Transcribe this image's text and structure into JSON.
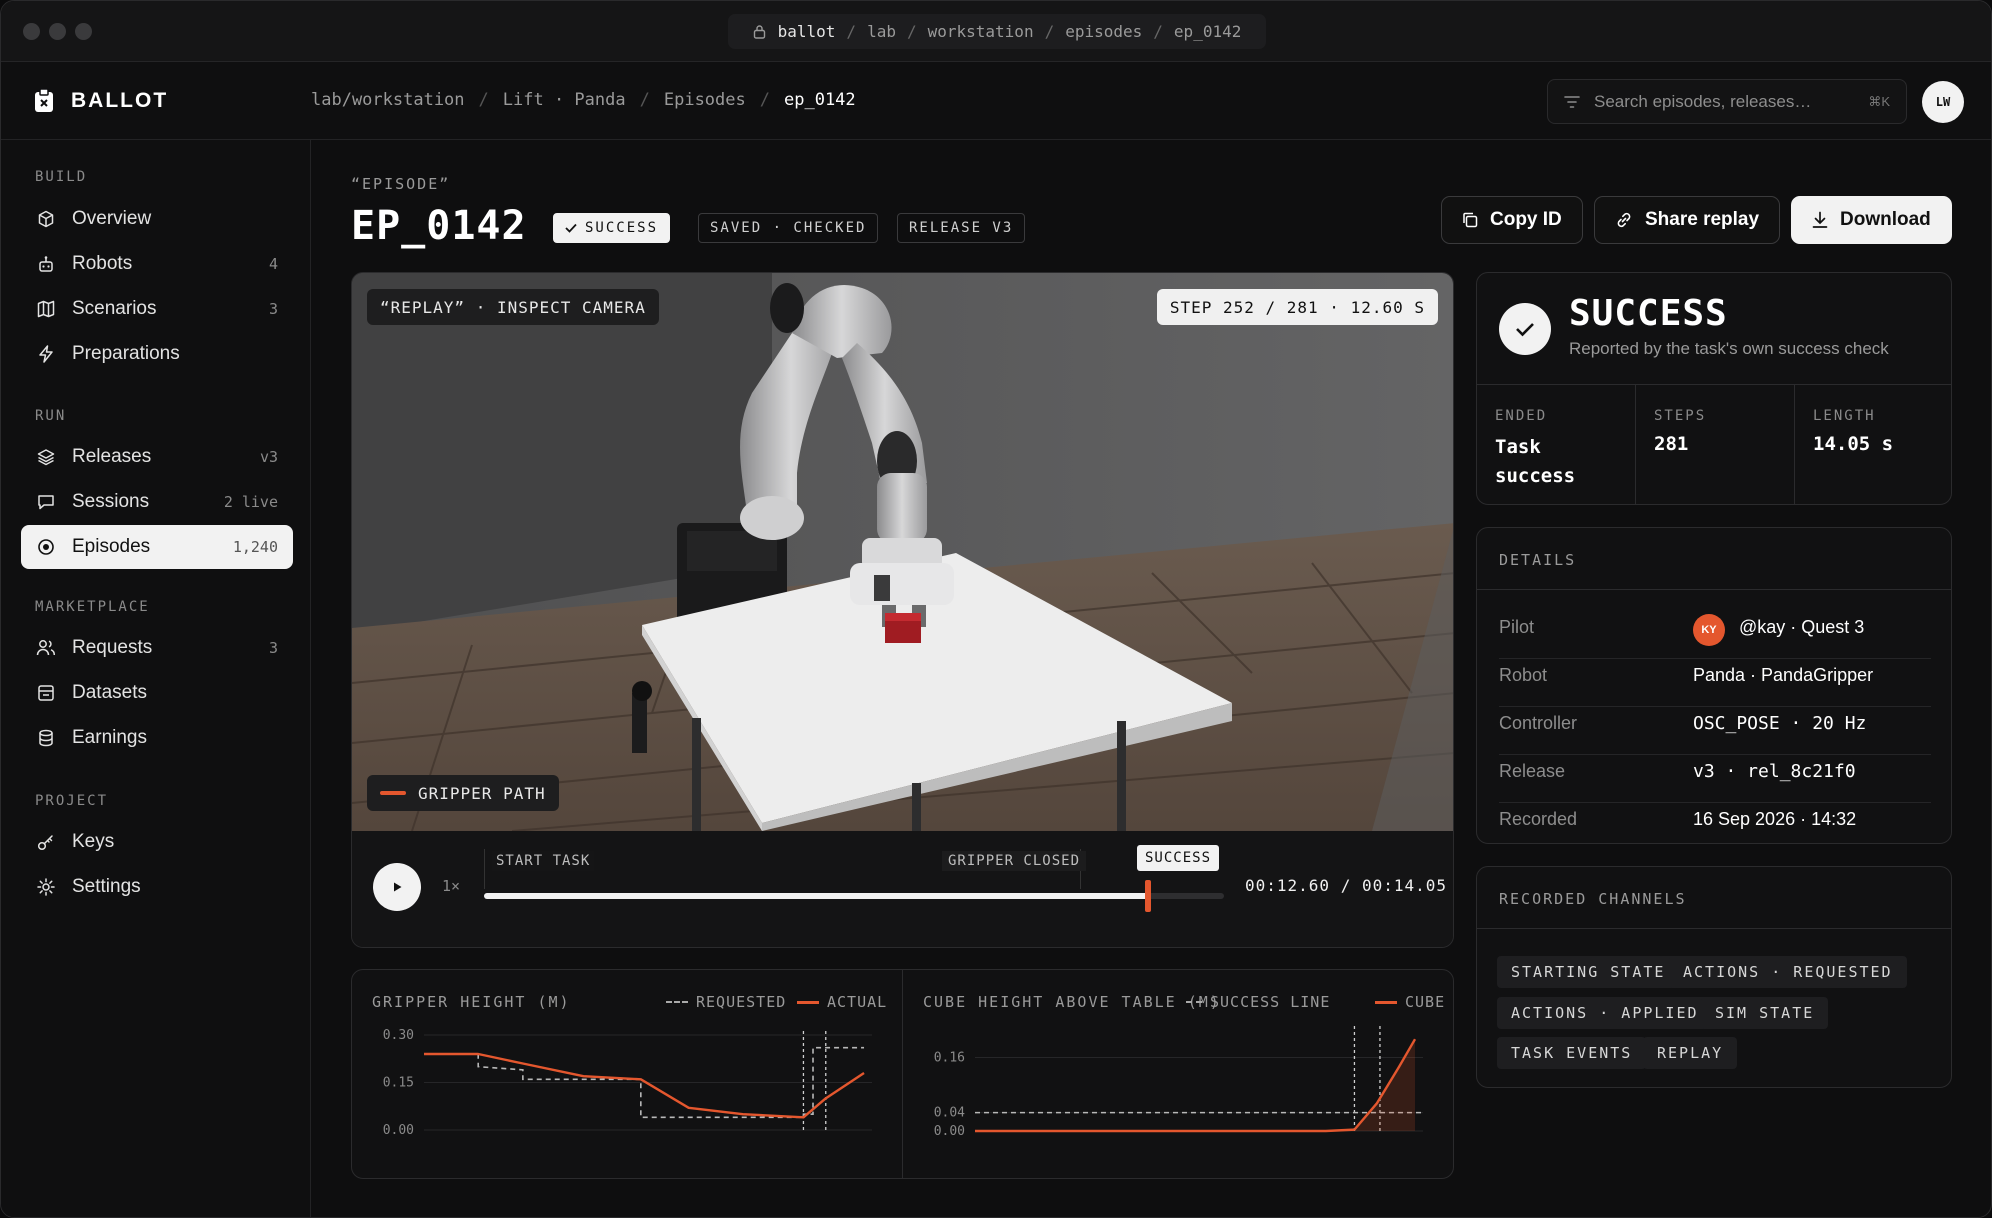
{
  "window": {
    "url_parts": [
      "ballot",
      "lab",
      "workstation",
      "episodes",
      "ep_0142"
    ]
  },
  "brand": {
    "name": "BALLOT"
  },
  "breadcrumb": [
    "lab/workstation",
    "Lift · Panda",
    "Episodes",
    "ep_0142"
  ],
  "search": {
    "placeholder": "Search episodes, releases…",
    "shortcut": "⌘K"
  },
  "user": {
    "initials": "LW"
  },
  "sidebar": {
    "sections": [
      "BUILD",
      "RUN",
      "MARKETPLACE",
      "PROJECT"
    ],
    "items": [
      {
        "label": "Overview",
        "count": ""
      },
      {
        "label": "Robots",
        "count": "4"
      },
      {
        "label": "Scenarios",
        "count": "3"
      },
      {
        "label": "Preparations",
        "count": ""
      },
      {
        "label": "Releases",
        "count": "v3"
      },
      {
        "label": "Sessions",
        "count": "2 live"
      },
      {
        "label": "Episodes",
        "count": "1,240"
      },
      {
        "label": "Requests",
        "count": "3"
      },
      {
        "label": "Datasets",
        "count": ""
      },
      {
        "label": "Earnings",
        "count": ""
      },
      {
        "label": "Keys",
        "count": ""
      },
      {
        "label": "Settings",
        "count": ""
      }
    ]
  },
  "episode": {
    "kicker": "“EPISODE”",
    "title": "EP_0142",
    "pills": [
      "SUCCESS",
      "SAVED · CHECKED",
      "RELEASE V3"
    ],
    "actions": {
      "copy": "Copy ID",
      "share": "Share replay",
      "download": "Download"
    }
  },
  "viewer": {
    "mode_tag": "“REPLAY” · INSPECT CAMERA",
    "step_tag": "STEP 252 / 281 · 12.60 S",
    "overlay_tag": "GRIPPER PATH",
    "speed": "1×",
    "markers": [
      "START TASK",
      "GRIPPER CLOSED",
      "SUCCESS"
    ],
    "time": "00:12.60 / 00:14.05",
    "progress": 0.897
  },
  "result": {
    "title": "SUCCESS",
    "subtitle": "Reported by the task's own success check",
    "stats": [
      {
        "label": "ENDED",
        "value": "Task success"
      },
      {
        "label": "STEPS",
        "value": "281"
      },
      {
        "label": "LENGTH",
        "value": "14.05 s"
      }
    ]
  },
  "details": {
    "header": "DETAILS",
    "rows": [
      {
        "label": "Pilot",
        "value": "@kay · Quest 3",
        "badge": "KY"
      },
      {
        "label": "Robot",
        "value": "Panda · PandaGripper"
      },
      {
        "label": "Controller",
        "value": "OSC_POSE · 20 Hz"
      },
      {
        "label": "Release",
        "value": "v3 · rel_8c21f0"
      },
      {
        "label": "Recorded",
        "value": "16 Sep 2026 · 14:32"
      }
    ]
  },
  "channels": {
    "header": "RECORDED CHANNELS",
    "items": [
      "STARTING STATE",
      "ACTIONS · REQUESTED",
      "ACTIONS · APPLIED",
      "SIM STATE",
      "TASK EVENTS",
      "REPLAY"
    ]
  },
  "colors": {
    "accent": "#e4572e",
    "success_bg": "#f2f2f2"
  },
  "chart_data": [
    {
      "type": "line",
      "title": "GRIPPER HEIGHT (M)",
      "yticks": [
        "0.30",
        "0.15",
        "0.00"
      ],
      "ylim": [
        0,
        0.3
      ],
      "xlim": [
        0,
        14.05
      ],
      "series": [
        {
          "name": "REQUESTED",
          "style": "dashed",
          "x": [
            0,
            1.7,
            1.7,
            3.1,
            3.1,
            6.8,
            6.8,
            11.9,
            11.9,
            12.2,
            12.2,
            13.8
          ],
          "y": [
            0.24,
            0.24,
            0.2,
            0.19,
            0.16,
            0.16,
            0.04,
            0.04,
            0.05,
            0.05,
            0.26,
            0.26
          ]
        },
        {
          "name": "ACTUAL",
          "style": "solid",
          "x": [
            0,
            1.7,
            3.1,
            5.0,
            6.8,
            8.3,
            10.0,
            11.9,
            12.6,
            13.8
          ],
          "y": [
            0.24,
            0.24,
            0.21,
            0.17,
            0.16,
            0.07,
            0.05,
            0.04,
            0.1,
            0.18
          ]
        }
      ]
    },
    {
      "type": "line",
      "title": "CUBE HEIGHT ABOVE TABLE (M)",
      "yticks": [
        "0.16",
        "0.04",
        "0.00"
      ],
      "ylim": [
        0,
        0.22
      ],
      "xlim": [
        0,
        14.05
      ],
      "series": [
        {
          "name": "SUCCESS LINE",
          "style": "dashed",
          "x": [
            0,
            14.05
          ],
          "y": [
            0.04,
            0.04
          ]
        },
        {
          "name": "CUBE",
          "style": "solid",
          "x": [
            0,
            11.0,
            11.9,
            12.6,
            13.3,
            13.8
          ],
          "y": [
            0,
            0,
            0.003,
            0.06,
            0.14,
            0.2
          ]
        }
      ]
    }
  ]
}
